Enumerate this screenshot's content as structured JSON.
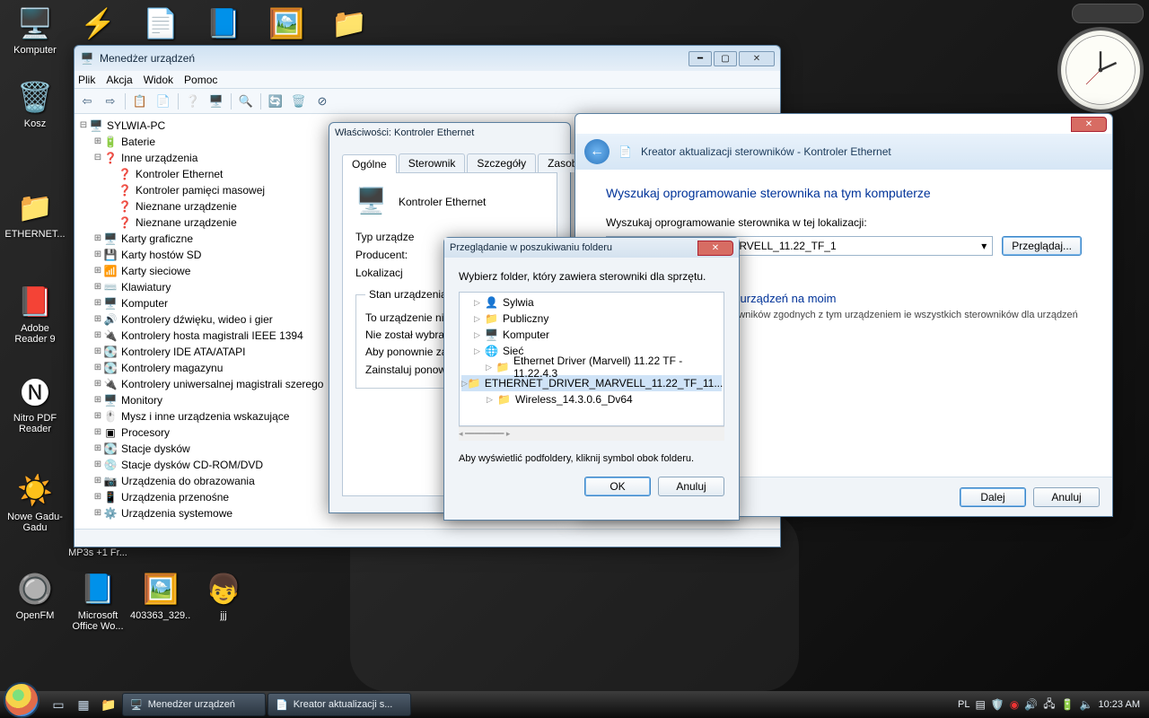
{
  "desktop": {
    "icons": [
      {
        "label": "Komputer",
        "glyph": "🖥️"
      },
      {
        "label": "",
        "glyph": "⚡",
        "name": "winamp"
      },
      {
        "label": "",
        "glyph": "📄",
        "name": "doc1"
      },
      {
        "label": "",
        "glyph": "📘",
        "name": "doc-word"
      },
      {
        "label": "",
        "glyph": "🖼️",
        "name": "photo"
      },
      {
        "label": "",
        "glyph": "📁",
        "name": "folder-top"
      },
      {
        "label": "Kosz",
        "glyph": "🗑️"
      },
      {
        "label": "ETHERNET...",
        "glyph": "📁"
      },
      {
        "label": "Adobe Reader 9",
        "glyph": "📕"
      },
      {
        "label": "Nitro PDF Reader",
        "glyph": "🅝"
      },
      {
        "label": "Nowe Gadu-Gadu",
        "glyph": "☀️"
      },
      {
        "label": "MP3s +1 Fr...",
        "glyph": "📁"
      },
      {
        "label": "OpenFM",
        "glyph": "🔘"
      },
      {
        "label": "Microsoft Office Wo...",
        "glyph": "📘"
      },
      {
        "label": "403363_329...",
        "glyph": "🖼️"
      },
      {
        "label": "jjj",
        "glyph": "👦"
      }
    ]
  },
  "devmgr": {
    "title": "Menedżer urządzeń",
    "menus": [
      "Plik",
      "Akcja",
      "Widok",
      "Pomoc"
    ],
    "root": "SYLWIA-PC",
    "nodes": [
      {
        "label": "Baterie",
        "glyph": "🔋",
        "exp": "+"
      },
      {
        "label": "Inne urządzenia",
        "glyph": "❓",
        "exp": "-",
        "children": [
          {
            "label": "Kontroler Ethernet",
            "glyph": "❓"
          },
          {
            "label": "Kontroler pamięci masowej",
            "glyph": "❓"
          },
          {
            "label": "Nieznane urządzenie",
            "glyph": "❓"
          },
          {
            "label": "Nieznane urządzenie",
            "glyph": "❓"
          }
        ]
      },
      {
        "label": "Karty graficzne",
        "glyph": "🖥️",
        "exp": "+"
      },
      {
        "label": "Karty hostów SD",
        "glyph": "💾",
        "exp": "+"
      },
      {
        "label": "Karty sieciowe",
        "glyph": "📶",
        "exp": "+"
      },
      {
        "label": "Klawiatury",
        "glyph": "⌨️",
        "exp": "+"
      },
      {
        "label": "Komputer",
        "glyph": "🖥️",
        "exp": "+"
      },
      {
        "label": "Kontrolery dźwięku, wideo i gier",
        "glyph": "🔊",
        "exp": "+"
      },
      {
        "label": "Kontrolery hosta magistrali IEEE 1394",
        "glyph": "🔌",
        "exp": "+"
      },
      {
        "label": "Kontrolery IDE ATA/ATAPI",
        "glyph": "💽",
        "exp": "+"
      },
      {
        "label": "Kontrolery magazynu",
        "glyph": "💽",
        "exp": "+"
      },
      {
        "label": "Kontrolery uniwersalnej magistrali szerego",
        "glyph": "🔌",
        "exp": "+"
      },
      {
        "label": "Monitory",
        "glyph": "🖥️",
        "exp": "+"
      },
      {
        "label": "Mysz i inne urządzenia wskazujące",
        "glyph": "🖱️",
        "exp": "+"
      },
      {
        "label": "Procesory",
        "glyph": "▣",
        "exp": "+"
      },
      {
        "label": "Stacje dysków",
        "glyph": "💽",
        "exp": "+"
      },
      {
        "label": "Stacje dysków CD-ROM/DVD",
        "glyph": "💿",
        "exp": "+"
      },
      {
        "label": "Urządzenia do obrazowania",
        "glyph": "📷",
        "exp": "+"
      },
      {
        "label": "Urządzenia przenośne",
        "glyph": "📱",
        "exp": "+"
      },
      {
        "label": "Urządzenia systemowe",
        "glyph": "⚙️",
        "exp": "+"
      }
    ]
  },
  "props": {
    "title": "Właściwości: Kontroler Ethernet",
    "tabs": [
      "Ogólne",
      "Sterownik",
      "Szczegóły",
      "Zasoby"
    ],
    "device_name": "Kontroler Ethernet",
    "fields": {
      "type_label": "Typ urządze",
      "mfr_label": "Producent:",
      "loc_label": "Lokalizacj"
    },
    "status_legend": "Stan urządzenia",
    "status_lines": [
      "To urządzenie nie",
      "Nie został wybran",
      "Aby ponownie zair",
      "Zainstaluj ponown"
    ]
  },
  "wizard": {
    "title": "Kreator aktualizacji sterowników - Kontroler Ethernet",
    "h1": "Wyszukaj oprogramowanie sterownika na tym komputerze",
    "search_label": "Wyszukaj oprogramowanie sterownika w tej lokalizacji:",
    "combo_value": "ETHERNET_DRIVER_MARVELL_11.22_TF_1",
    "browse_btn": "Przeglądaj...",
    "link": "rać z listy sterowników urządzeń na moim",
    "link_text": "lowane oprogramowanie sterowników zgodnych z tym urządzeniem ie wszystkich sterowników dla urządzeń z tej samej kategorii.",
    "next": "Dalej",
    "cancel": "Anuluj"
  },
  "browse": {
    "title": "Przeglądanie w poszukiwaniu folderu",
    "prompt": "Wybierz folder, który zawiera sterowniki dla sprzętu.",
    "note": "Aby wyświetlić podfoldery, kliknij symbol obok folderu.",
    "ok": "OK",
    "cancel": "Anuluj",
    "items": [
      {
        "label": "Sylwia",
        "glyph": "👤",
        "indent": 1,
        "exp": "▷"
      },
      {
        "label": "Publiczny",
        "glyph": "📁",
        "indent": 1,
        "exp": "▷"
      },
      {
        "label": "Komputer",
        "glyph": "🖥️",
        "indent": 1,
        "exp": "▷"
      },
      {
        "label": "Sieć",
        "glyph": "🌐",
        "indent": 1,
        "exp": "▷"
      },
      {
        "label": "Ethernet Driver (Marvell) 11.22 TF - 11.22.4.3",
        "glyph": "📁",
        "indent": 2,
        "exp": "▷"
      },
      {
        "label": "ETHERNET_DRIVER_MARVELL_11.22_TF_11...",
        "glyph": "📁",
        "indent": 2,
        "exp": "▷",
        "selected": true
      },
      {
        "label": "Wireless_14.3.0.6_Dv64",
        "glyph": "📁",
        "indent": 2,
        "exp": "▷"
      }
    ]
  },
  "taskbar": {
    "tasks": [
      {
        "icon": "🖥️",
        "label": "Menedżer urządzeń"
      },
      {
        "icon": "📄",
        "label": "Kreator aktualizacji s..."
      }
    ],
    "lang": "PL",
    "time": "10:23 AM"
  }
}
